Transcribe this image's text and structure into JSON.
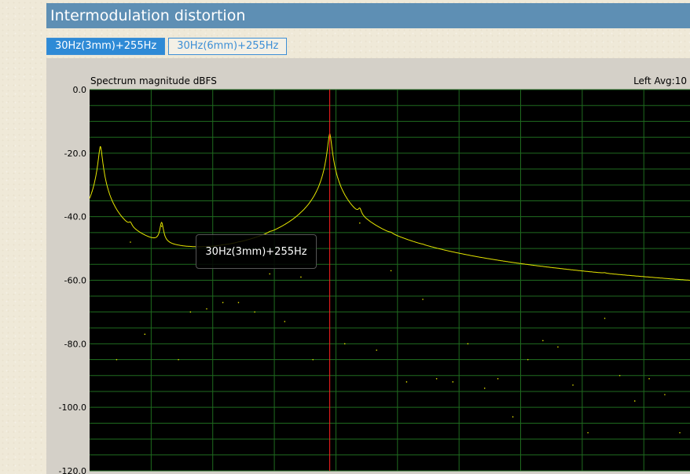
{
  "header": {
    "title": "Intermodulation distortion"
  },
  "tabs": [
    {
      "label": "30Hz(3mm)+255Hz",
      "active": true
    },
    {
      "label": "30Hz(6mm)+255Hz",
      "active": false
    }
  ],
  "colors": {
    "header_bg": "#5e8fb4",
    "tab_accent": "#2e8ad6",
    "plot_bg": "#000000",
    "grid": "#1f6b1f",
    "trace": "#e6e600",
    "marker": "#ff2020"
  },
  "tooltip": {
    "text": "30Hz(3mm)+255Hz"
  },
  "chart_data": {
    "type": "line",
    "title": "Spectrum magnitude dBFS",
    "info": "Left  Avg:10",
    "ylabel": "",
    "xlabel": "",
    "ylim": [
      -120,
      0
    ],
    "yticks": [
      "0.0",
      "-20.0",
      "-40.0",
      "-60.0",
      "-80.0",
      "-100.0",
      "-120.0"
    ],
    "grid": true,
    "noise_floor": -112,
    "marker_position": 0.4,
    "series": [
      {
        "peaks": [
          {
            "x": 0.018,
            "db": -18
          },
          {
            "x": 0.045,
            "db": -85
          },
          {
            "x": 0.068,
            "db": -48
          },
          {
            "x": 0.092,
            "db": -77
          },
          {
            "x": 0.12,
            "db": -43
          },
          {
            "x": 0.148,
            "db": -85
          },
          {
            "x": 0.168,
            "db": -70
          },
          {
            "x": 0.195,
            "db": -69
          },
          {
            "x": 0.222,
            "db": -67
          },
          {
            "x": 0.248,
            "db": -67
          },
          {
            "x": 0.275,
            "db": -70
          },
          {
            "x": 0.3,
            "db": -58
          },
          {
            "x": 0.325,
            "db": -73
          },
          {
            "x": 0.352,
            "db": -59
          },
          {
            "x": 0.372,
            "db": -85
          },
          {
            "x": 0.4,
            "db": -14
          },
          {
            "x": 0.425,
            "db": -80
          },
          {
            "x": 0.45,
            "db": -42
          },
          {
            "x": 0.478,
            "db": -82
          },
          {
            "x": 0.502,
            "db": -57
          },
          {
            "x": 0.528,
            "db": -92
          },
          {
            "x": 0.555,
            "db": -66
          },
          {
            "x": 0.578,
            "db": -91
          },
          {
            "x": 0.605,
            "db": -92
          },
          {
            "x": 0.63,
            "db": -80
          },
          {
            "x": 0.658,
            "db": -94
          },
          {
            "x": 0.68,
            "db": -91
          },
          {
            "x": 0.705,
            "db": -103
          },
          {
            "x": 0.73,
            "db": -85
          },
          {
            "x": 0.755,
            "db": -79
          },
          {
            "x": 0.78,
            "db": -81
          },
          {
            "x": 0.805,
            "db": -93
          },
          {
            "x": 0.83,
            "db": -108
          },
          {
            "x": 0.858,
            "db": -72
          },
          {
            "x": 0.883,
            "db": -90
          },
          {
            "x": 0.908,
            "db": -98
          },
          {
            "x": 0.932,
            "db": -91
          },
          {
            "x": 0.958,
            "db": -96
          },
          {
            "x": 0.983,
            "db": -108
          }
        ]
      }
    ]
  }
}
